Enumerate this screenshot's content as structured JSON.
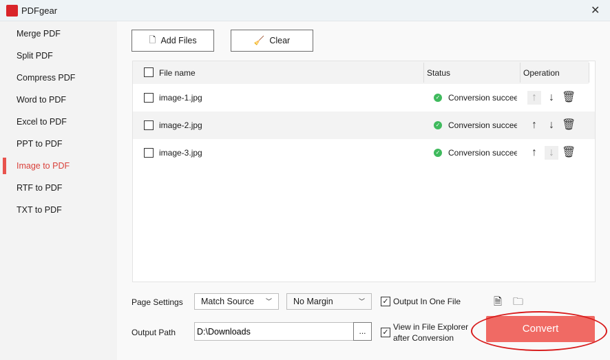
{
  "app": {
    "title": "PDFgear",
    "logo_text": "PDF"
  },
  "sidebar": {
    "items": [
      {
        "label": "Merge PDF"
      },
      {
        "label": "Split PDF"
      },
      {
        "label": "Compress PDF"
      },
      {
        "label": "Word to PDF"
      },
      {
        "label": "Excel to PDF"
      },
      {
        "label": "PPT to PDF"
      },
      {
        "label": "Image to PDF",
        "active": true
      },
      {
        "label": "RTF to PDF"
      },
      {
        "label": "TXT to PDF"
      }
    ]
  },
  "toolbar": {
    "add_files": "Add Files",
    "clear": "Clear"
  },
  "table": {
    "columns": [
      "File name",
      "Status",
      "Operation"
    ],
    "rows": [
      {
        "name": "image-1.jpg",
        "status": "Conversion succeeded"
      },
      {
        "name": "image-2.jpg",
        "status": "Conversion succeeded"
      },
      {
        "name": "image-3.jpg",
        "status": "Conversion succeeded"
      }
    ]
  },
  "settings": {
    "page_settings_label": "Page Settings",
    "page_size": "Match Source",
    "margin": "No Margin",
    "output_one_file": "Output In One File",
    "output_one_file_checked": true,
    "output_path_label": "Output Path",
    "output_path": "D:\\Downloads",
    "browse": "...",
    "view_explorer_1": "View in File Explorer",
    "view_explorer_2": "after Conversion",
    "view_explorer_checked": true,
    "convert": "Convert"
  },
  "colors": {
    "accent": "#f06a64",
    "success": "#3fba5d",
    "annotation": "#d81e1e"
  }
}
